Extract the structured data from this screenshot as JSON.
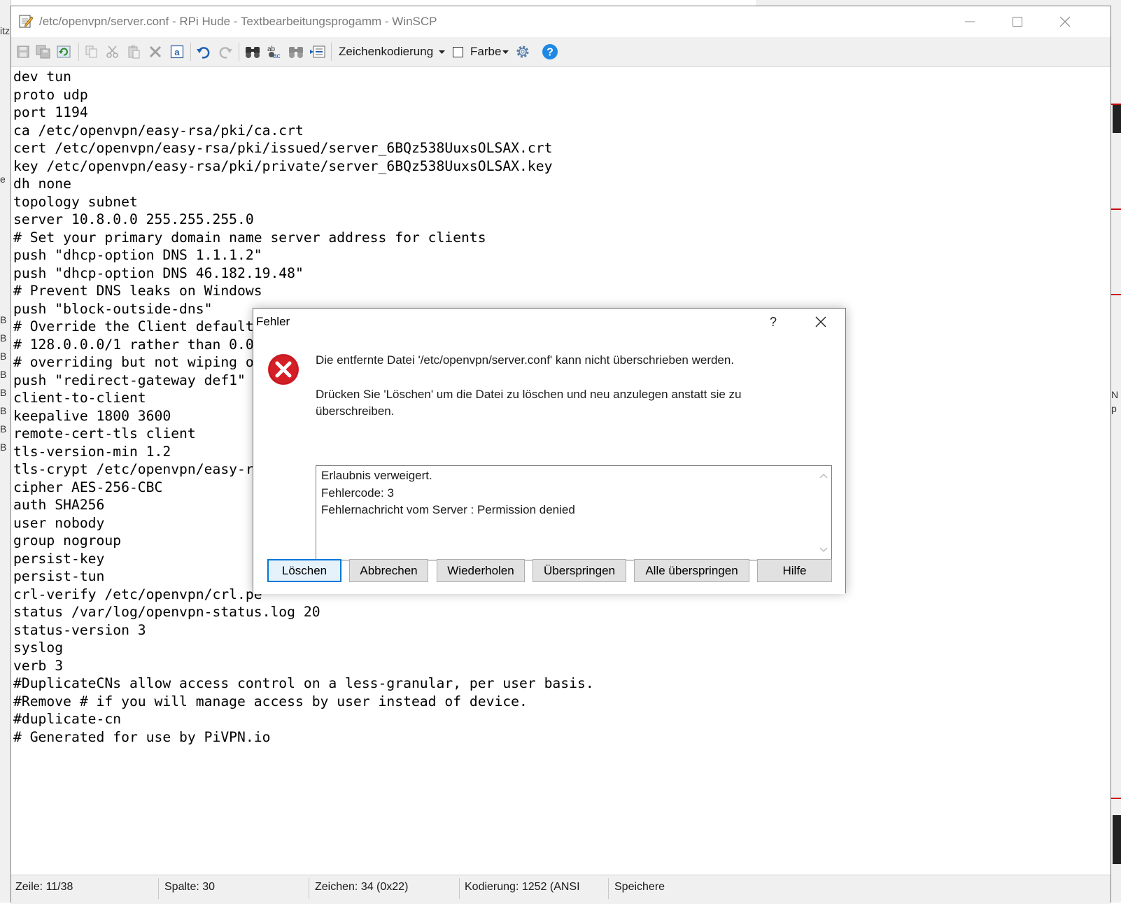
{
  "window": {
    "title": "/etc/openvpn/server.conf - RPi Hude - Textbearbeitungsprogamm - WinSCP"
  },
  "toolbar": {
    "encoding_label": "Zeichenkodierung",
    "color_label": "Farbe",
    "icons": [
      "save-icon",
      "save-all-icon",
      "reload-icon",
      "copy-icon",
      "cut-icon",
      "paste-icon",
      "delete-icon",
      "select-all-icon",
      "undo-icon",
      "redo-icon",
      "find-icon",
      "replace-icon",
      "find-next-icon",
      "goto-line-icon",
      "settings-icon",
      "help-icon"
    ]
  },
  "editor": {
    "lines": [
      "dev tun",
      "proto udp",
      "port 1194",
      "ca /etc/openvpn/easy-rsa/pki/ca.crt",
      "cert /etc/openvpn/easy-rsa/pki/issued/server_6BQz538UuxsOLSAX.crt",
      "key /etc/openvpn/easy-rsa/pki/private/server_6BQz538UuxsOLSAX.key",
      "dh none",
      "topology subnet",
      "server 10.8.0.0 255.255.255.0",
      "# Set your primary domain name server address for clients",
      "push \"dhcp-option DNS 1.1.1.2\"",
      "push \"dhcp-option DNS 46.182.19.48\"",
      "# Prevent DNS leaks on Windows",
      "push \"block-outside-dns\"",
      "# Override the Client default",
      "# 128.0.0.0/1 rather than 0.0",
      "# overriding but not wiping ou",
      "push \"redirect-gateway def1\"",
      "client-to-client",
      "keepalive 1800 3600",
      "remote-cert-tls client",
      "tls-version-min 1.2",
      "tls-crypt /etc/openvpn/easy-rs",
      "cipher AES-256-CBC",
      "auth SHA256",
      "user nobody",
      "group nogroup",
      "persist-key",
      "persist-tun",
      "crl-verify /etc/openvpn/crl.pe",
      "status /var/log/openvpn-status.log 20",
      "status-version 3",
      "syslog",
      "verb 3",
      "#DuplicateCNs allow access control on a less-granular, per user basis.",
      "#Remove # if you will manage access by user instead of device.",
      "#duplicate-cn",
      "# Generated for use by PiVPN.io"
    ]
  },
  "status": {
    "line": "Zeile: 11/38",
    "column": "Spalte: 30",
    "char": "Zeichen: 34 (0x22)",
    "encoding": "Kodierung: 1252  (ANSI",
    "saved": "Speichere"
  },
  "dialog": {
    "title": "Fehler",
    "help_glyph": "?",
    "message": "Die entfernte Datei '/etc/openvpn/server.conf' kann nicht überschrieben werden.",
    "hint_line1": "Drücken Sie 'Löschen' um die Datei zu löschen und neu anzulegen anstatt sie zu",
    "hint_line2": "überschreiben.",
    "details": [
      "Erlaubnis verweigert.",
      "Fehlercode: 3",
      "Fehlernachricht vom Server : Permission denied"
    ],
    "buttons": {
      "delete": "Löschen",
      "cancel": "Abbrechen",
      "retry": "Wiederholen",
      "skip": "Überspringen",
      "skip_all": "Alle überspringen",
      "help": "Hilfe"
    }
  },
  "background": {
    "left_fragments": [
      "itz",
      "e",
      "B",
      "B",
      "B",
      "B",
      "B",
      "B",
      "B",
      "B"
    ],
    "right_fragments": [
      "N",
      "p"
    ]
  },
  "colors": {
    "accent": "#0078d7",
    "error": "#d51f26",
    "help": "#1e88e5"
  }
}
